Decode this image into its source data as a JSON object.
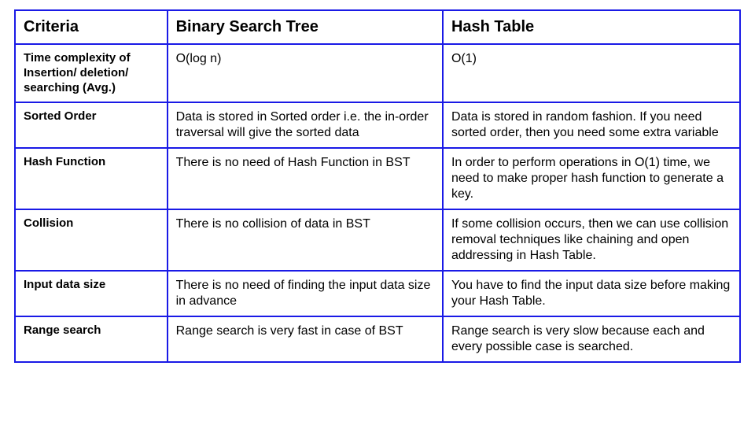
{
  "table": {
    "headers": [
      "Criteria",
      "Binary Search Tree",
      "Hash Table"
    ],
    "rows": [
      {
        "label": "Time complexity of Insertion/ deletion/ searching (Avg.)",
        "bst": "O(log n)",
        "hash": "O(1)"
      },
      {
        "label": "Sorted Order",
        "bst": "Data is stored in Sorted order i.e. the in-order traversal will give the sorted data",
        "hash": "Data is stored in random fashion. If you need sorted order, then you need some extra variable"
      },
      {
        "label": "Hash Function",
        "bst": "There is no need of Hash Function in BST",
        "hash": "In order to perform operations in O(1) time, we need to make proper hash function to generate a key."
      },
      {
        "label": "Collision",
        "bst": "There is no collision of data in BST",
        "hash": "If some collision occurs, then we can use collision removal techniques like chaining and open addressing in Hash Table."
      },
      {
        "label": "Input data size",
        "bst": "There is no need of finding the input data size in advance",
        "hash": "You have to find the input data size before making your Hash Table."
      },
      {
        "label": "Range search",
        "bst": "Range search is very fast in case of BST",
        "hash": "Range search is very slow because each and every possible case is searched."
      }
    ]
  }
}
